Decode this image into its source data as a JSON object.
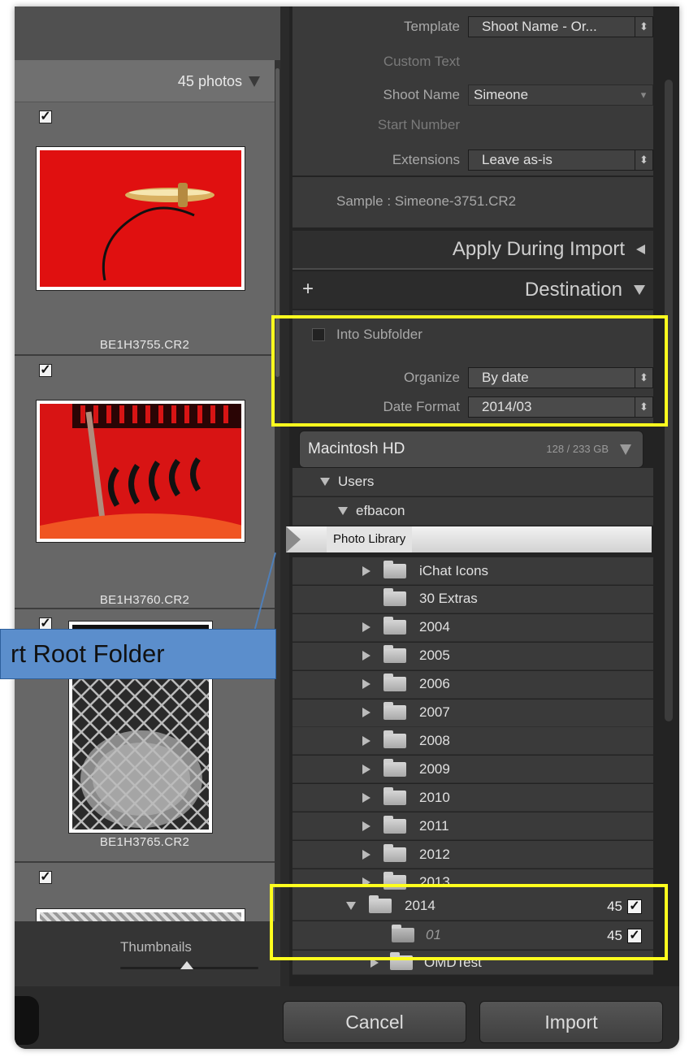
{
  "grid": {
    "photo_count": "45 photos",
    "cells": [
      {
        "filename": "BE1H3755.CR2",
        "checked": true
      },
      {
        "filename": "BE1H3760.CR2",
        "checked": true
      },
      {
        "filename": "BE1H3765.CR2",
        "checked": true
      },
      {
        "filename": "",
        "checked": true
      }
    ],
    "thumbnails_label": "Thumbnails",
    "thumbnail_size_level": 0.48
  },
  "file_renaming": {
    "template_label": "Template",
    "template_value": "Shoot Name - Or...",
    "custom_text_label": "Custom Text",
    "shoot_name_label": "Shoot Name",
    "shoot_name_value": "Simeone",
    "start_number_label": "Start Number",
    "extensions_label": "Extensions",
    "extensions_value": "Leave as-is",
    "sample": "Sample :  Simeone-3751.CR2"
  },
  "apply_during_import": {
    "title": "Apply During Import"
  },
  "destination": {
    "title": "Destination",
    "add_symbol": "+",
    "into_subfolder_label": "Into Subfolder",
    "into_subfolder_checked": false,
    "organize_label": "Organize",
    "organize_value": "By date",
    "date_format_label": "Date Format",
    "date_format_value": "2014/03",
    "volume_name": "Macintosh HD",
    "volume_space": "128 / 233 GB",
    "tree": {
      "users": "Users",
      "user": "efbacon",
      "photo_library": "Photo Library",
      "folders": [
        "iChat Icons",
        "30 Extras",
        "2004",
        "2005",
        "2006",
        "2007",
        "2008",
        "2009",
        "2010",
        "2011",
        "2012",
        "2013"
      ],
      "year_2014": "2014",
      "year_2014_count": "45",
      "new_subfolder": "01",
      "new_subfolder_count": "45",
      "after": "OMDTest"
    }
  },
  "callout": {
    "text": "rt Root Folder"
  },
  "buttons": {
    "cancel": "Cancel",
    "import": "Import"
  },
  "colors": {
    "highlight": "#ffff1e",
    "callout": "#5b8ecc",
    "panel": "#3a3a3a"
  }
}
